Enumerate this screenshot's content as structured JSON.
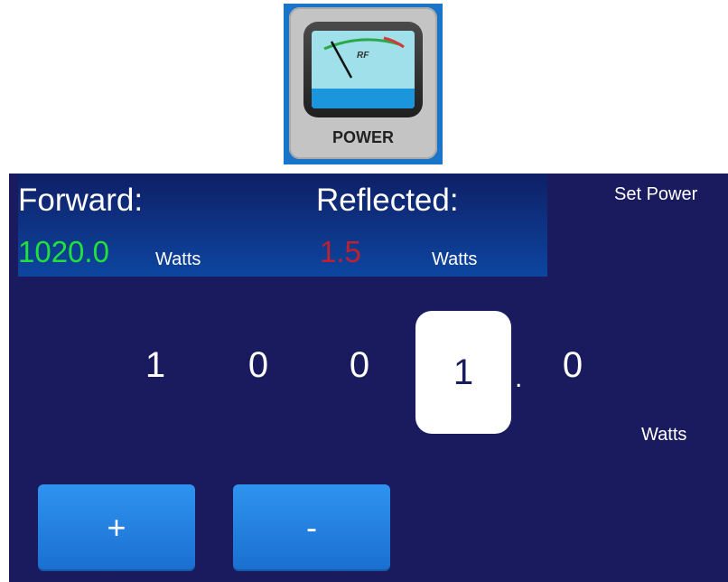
{
  "icon_tile": {
    "label": "POWER",
    "meter_text": "RF",
    "icon": "rf-power-meter-icon"
  },
  "readout": {
    "forward_label": "Forward:",
    "forward_value": "1020.0",
    "forward_unit": "Watts",
    "reflected_label": "Reflected:",
    "reflected_value": "1.5",
    "reflected_unit": "Watts"
  },
  "set_power": {
    "title": "Set Power",
    "digits": [
      "1",
      "0",
      "0",
      "1",
      "0"
    ],
    "selected_digit_index": 3,
    "decimal": ".",
    "unit": "Watts"
  },
  "buttons": {
    "increment_label": "+",
    "decrement_label": "-"
  },
  "colors": {
    "panel_bg": "#1a1a5e",
    "forward_value": "#22e03a",
    "reflected_value": "#c02030",
    "button": "#2f93f0",
    "tile_border": "#1a74c8"
  }
}
